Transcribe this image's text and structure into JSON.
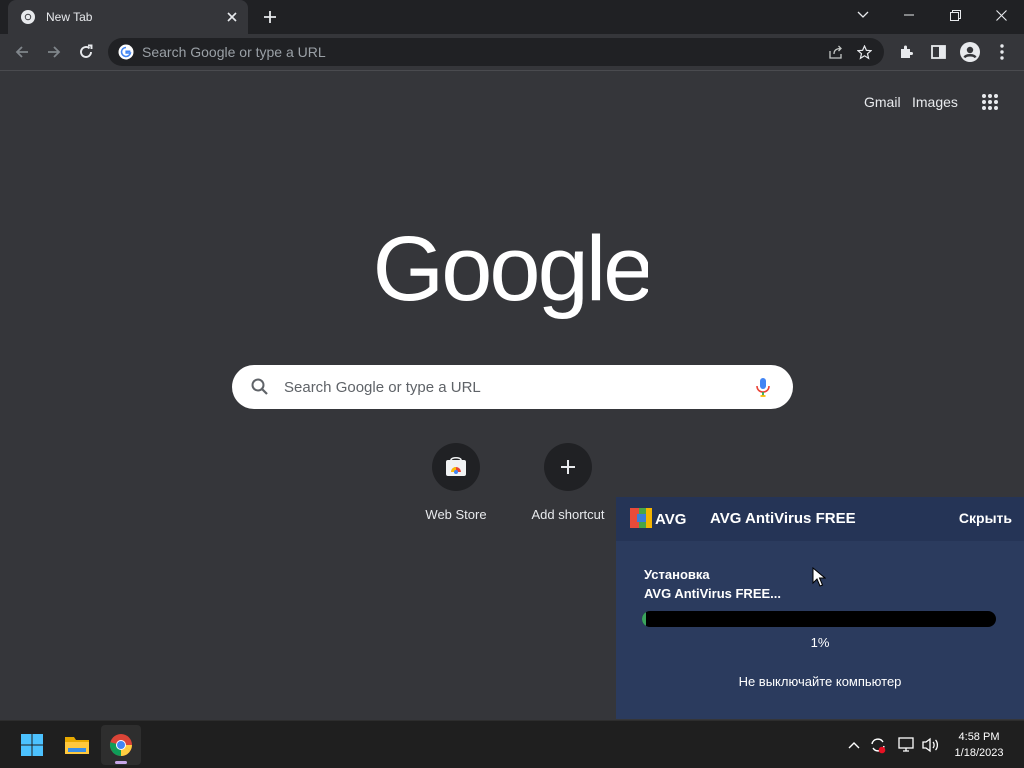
{
  "browser": {
    "tab_title": "New Tab",
    "omnibox_placeholder": "Search Google or type a URL"
  },
  "ntp": {
    "header_links": [
      "Gmail",
      "Images"
    ],
    "logo_text": "Google",
    "search_placeholder": "Search Google or type a URL",
    "shortcuts": [
      {
        "label": "Web Store",
        "icon": "web-store-icon"
      },
      {
        "label": "Add shortcut",
        "icon": "plus-icon"
      }
    ]
  },
  "avg": {
    "title": "AVG AntiVirus FREE",
    "hide_label": "Скрыть",
    "logo_text": "AVG",
    "step_line1": "Установка",
    "step_line2": "AVG AntiVirus FREE...",
    "progress_percent": 1,
    "progress_label": "1%",
    "note": "Не выключайте компьютер"
  },
  "taskbar": {
    "apps": [
      "start-icon",
      "file-explorer-icon",
      "chrome-icon"
    ],
    "clock_time": "4:58 PM",
    "clock_date": "1/18/2023"
  },
  "colors": {
    "page_bg": "#35363a",
    "titlebar_bg": "#202124",
    "avg_bg": "#2b3b5e",
    "avg_progress": "#3aa35c"
  }
}
